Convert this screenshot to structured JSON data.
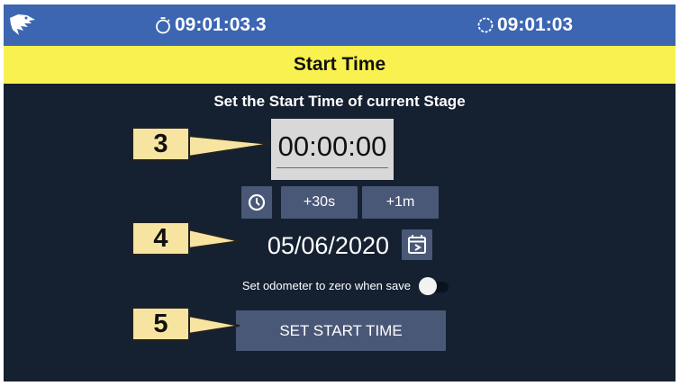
{
  "header": {
    "stopwatch_time": "09:01:03.3",
    "clock_time": "09:01:03",
    "icons": [
      "eagle-logo",
      "stopwatch-icon",
      "clock-icon"
    ]
  },
  "title": "Start Time",
  "subtitle": "Set the Start Time of current Stage",
  "time_value": "00:00:00",
  "buttons": {
    "plus30": "+30s",
    "plus1m": "+1m",
    "set_start": "SET START TIME"
  },
  "date_value": "05/06/2020",
  "odometer_label": "Set odometer to zero when save",
  "odometer_toggle": false,
  "callouts": [
    "3",
    "4",
    "5"
  ],
  "colors": {
    "topbar": "#3d66b2",
    "titlebar": "#f9f14f",
    "background": "#152031",
    "button": "#4a5878",
    "callout": "#f7e4a1"
  }
}
